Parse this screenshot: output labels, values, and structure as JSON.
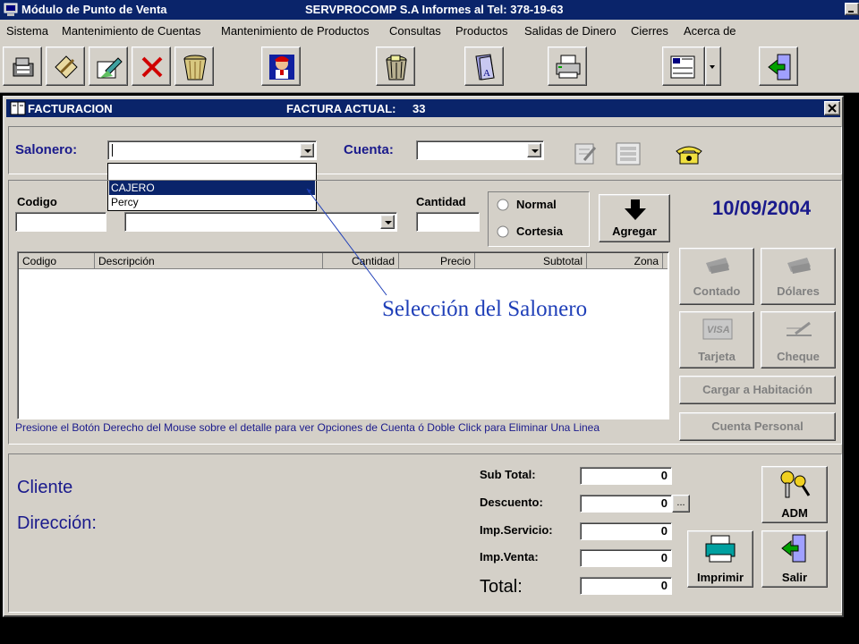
{
  "title_bar": {
    "app_title": "Módulo de Punto de Venta",
    "company_info": "SERVPROCOMP S.A  Informes al Tel:  378-19-63"
  },
  "menu": {
    "items": [
      "Sistema",
      "Mantenimiento de Cuentas",
      "Mantenimiento de Productos",
      "Consultas",
      "Productos",
      "Salidas de Dinero",
      "Cierres",
      "Acerca de"
    ]
  },
  "toolbar": {
    "icons": [
      "cash-register-icon",
      "document-edit-icon",
      "folder-edit-icon",
      "delete-icon",
      "basket-icon",
      "waiter-icon",
      "trash-bin-icon",
      "book-icon",
      "printer-icon",
      "calculator-icon",
      "exit-door-icon"
    ]
  },
  "window": {
    "title": "FACTURACION",
    "current_invoice_label": "FACTURA ACTUAL:",
    "current_invoice_value": "33"
  },
  "form": {
    "salonero_label": "Salonero:",
    "salonero_value": "",
    "cuenta_label": "Cuenta:",
    "cuenta_value": "",
    "salonero_options": [
      "",
      "CAJERO",
      "Percy"
    ],
    "salonero_highlighted": "CAJERO",
    "codigo_label": "Codigo",
    "cantidad_label": "Cantidad",
    "radio_normal": "Normal",
    "radio_cortesia": "Cortesia",
    "agregar_label": "Agregar",
    "date": "10/09/2004"
  },
  "grid": {
    "columns": [
      "Codigo",
      "Descripción",
      "Cantidad",
      "Precio",
      "Subtotal",
      "Zona"
    ],
    "rows": [],
    "hint": "Presione el Botón Derecho del Mouse sobre el detalle para ver Opciones de Cuenta ó Doble Click para Eliminar Una Linea"
  },
  "payment_buttons": {
    "contado": "Contado",
    "dolares": "Dólares",
    "tarjeta": "Tarjeta",
    "cheque": "Cheque",
    "habitacion": "Cargar a Habitación",
    "personal": "Cuenta Personal"
  },
  "customer": {
    "cliente_label": "Cliente",
    "direccion_label": "Dirección:"
  },
  "totals": {
    "subtotal_label": "Sub Total:",
    "subtotal_value": "0",
    "descuento_label": "Descuento:",
    "descuento_value": "0",
    "descuento_button": "...",
    "servicio_label": "Imp.Servicio:",
    "servicio_value": "0",
    "venta_label": "Imp.Venta:",
    "venta_value": "0",
    "total_label": "Total:",
    "total_value": "0"
  },
  "actions": {
    "adm": "ADM",
    "imprimir": "Imprimir",
    "salir": "Salir"
  },
  "annotation": {
    "text": "Selección del Salonero"
  },
  "colors": {
    "title_bar": "#0a246a",
    "face": "#d4d0c8",
    "label_blue": "#1a1a8c",
    "annotation": "#1f3fb8"
  }
}
